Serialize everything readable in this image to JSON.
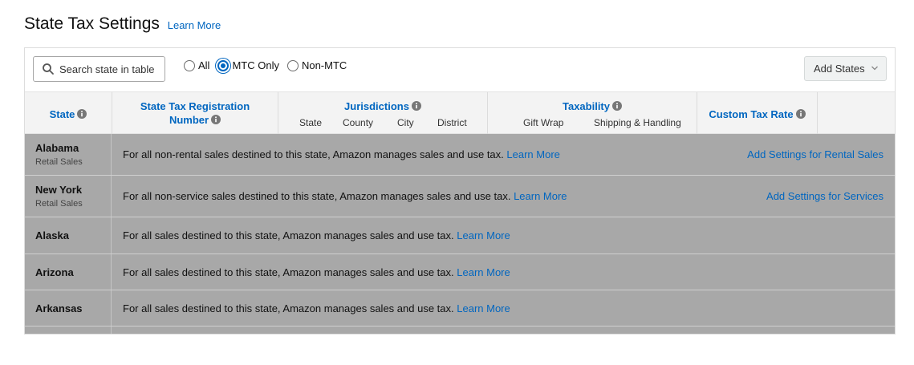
{
  "page": {
    "title": "State Tax Settings",
    "learn_more": "Learn More"
  },
  "toolbar": {
    "search_placeholder": "Search state in table",
    "radios": [
      {
        "label": "All",
        "checked": false
      },
      {
        "label": "MTC Only",
        "checked": true
      },
      {
        "label": "Non-MTC",
        "checked": false
      }
    ],
    "add_states_label": "Add States"
  },
  "header": {
    "state": "State",
    "registration_line1": "State Tax Registration",
    "registration_line2": "Number",
    "jurisdictions": "Jurisdictions",
    "jurisdiction_subcols": [
      "State",
      "County",
      "City",
      "District"
    ],
    "taxability": "Taxability",
    "taxability_subcols": [
      "Gift Wrap",
      "Shipping & Handling"
    ],
    "custom_tax_rate": "Custom Tax Rate"
  },
  "rows": [
    {
      "state": "Alabama",
      "sub": "Retail Sales",
      "message": "For all non-rental sales destined to this state, Amazon manages sales and use tax.",
      "link": "Learn More",
      "action": "Add Settings for Rental Sales"
    },
    {
      "state": "New York",
      "sub": "Retail Sales",
      "message": "For all non-service sales destined to this state, Amazon manages sales and use tax.",
      "link": "Learn More",
      "action": "Add Settings for Services"
    },
    {
      "state": "Alaska",
      "sub": "",
      "message": "For all sales destined to this state, Amazon manages sales and use tax.",
      "link": "Learn More",
      "action": ""
    },
    {
      "state": "Arizona",
      "sub": "",
      "message": "For all sales destined to this state, Amazon manages sales and use tax.",
      "link": "Learn More",
      "action": ""
    },
    {
      "state": "Arkansas",
      "sub": "",
      "message": "For all sales destined to this state, Amazon manages sales and use tax.",
      "link": "Learn More",
      "action": ""
    }
  ],
  "colors": {
    "link": "#0066c0",
    "row_bg": "#a8a8a8",
    "header_bg": "#f3f3f3"
  }
}
